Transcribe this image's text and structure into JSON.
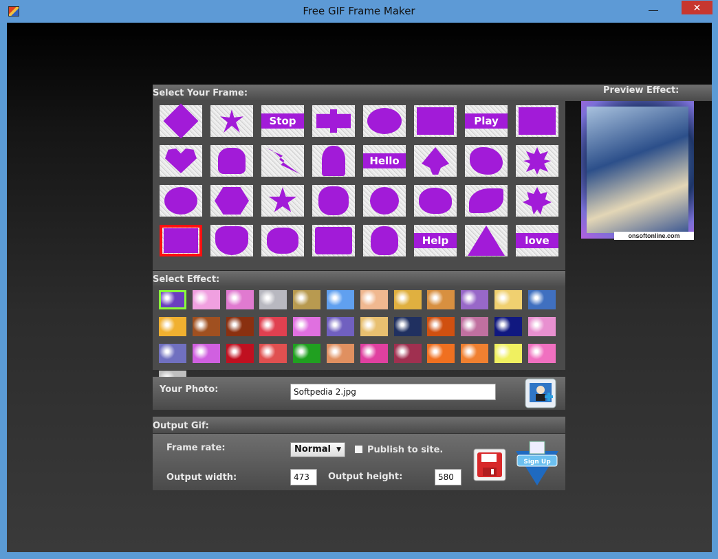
{
  "window": {
    "title": "Free GIF Frame Maker",
    "minimize_glyph": "—",
    "close_glyph": "✕"
  },
  "frames": {
    "heading": "Select Your Frame:",
    "items": [
      {
        "name": "diamond",
        "text": ""
      },
      {
        "name": "starburst",
        "text": ""
      },
      {
        "name": "stop",
        "text": "Stop"
      },
      {
        "name": "puzzle",
        "text": ""
      },
      {
        "name": "ellipse",
        "text": ""
      },
      {
        "name": "square",
        "text": ""
      },
      {
        "name": "play",
        "text": "Play"
      },
      {
        "name": "square-alt",
        "text": ""
      },
      {
        "name": "heart",
        "text": ""
      },
      {
        "name": "club",
        "text": ""
      },
      {
        "name": "lightning",
        "text": ""
      },
      {
        "name": "silhouette",
        "text": ""
      },
      {
        "name": "hello",
        "text": "Hello"
      },
      {
        "name": "spade",
        "text": ""
      },
      {
        "name": "splat",
        "text": ""
      },
      {
        "name": "star-badge",
        "text": ""
      },
      {
        "name": "circle",
        "text": ""
      },
      {
        "name": "hexagon",
        "text": ""
      },
      {
        "name": "star",
        "text": ""
      },
      {
        "name": "flower",
        "text": ""
      },
      {
        "name": "seal",
        "text": ""
      },
      {
        "name": "cloud",
        "text": ""
      },
      {
        "name": "leaf",
        "text": ""
      },
      {
        "name": "maple-leaf",
        "text": ""
      },
      {
        "name": "rough-square",
        "text": ""
      },
      {
        "name": "shield",
        "text": ""
      },
      {
        "name": "scribble",
        "text": ""
      },
      {
        "name": "rounded-square",
        "text": ""
      },
      {
        "name": "skull",
        "text": ""
      },
      {
        "name": "help",
        "text": "Help"
      },
      {
        "name": "triangle",
        "text": ""
      },
      {
        "name": "love",
        "text": "love"
      }
    ],
    "selected_index": 24
  },
  "effects": {
    "heading": "Select Effect:",
    "colors": [
      "#6b3fbf",
      "#f0a0e0",
      "#e07ad0",
      "#b8b8c0",
      "#b89a50",
      "#60a0f0",
      "#f0b890",
      "#e0b040",
      "#d89040",
      "#9868c8",
      "#f0d070",
      "#4070c0",
      "#f0b030",
      "#a05020",
      "#8a3010",
      "#e04050",
      "#e070e0",
      "#7060c0",
      "#e8c070",
      "#203060",
      "#d05010",
      "#c070a0",
      "#101880",
      "#e890d0",
      "#7070c0",
      "#d060e0",
      "#c01020",
      "#e05050",
      "#20a020",
      "#e09060",
      "#e040a0",
      "#a03050",
      "#f07020",
      "#f08030",
      "#f0f060",
      "#f070c0",
      "#c0c0c0"
    ],
    "selected_index": 0
  },
  "photo": {
    "label": "Your Photo:",
    "filename": "Softpedia 2.jpg"
  },
  "output": {
    "heading": "Output Gif:",
    "frame_rate_label": "Frame rate:",
    "frame_rate_value": "Normal",
    "publish_label": "Publish to site.",
    "publish_checked": false,
    "width_label": "Output width:",
    "width_value": "473",
    "height_label": "Output height:",
    "height_value": "580",
    "signup_label": "Sign Up"
  },
  "preview": {
    "heading": "Preview Effect:",
    "watermark": "onsoftonline.com"
  }
}
